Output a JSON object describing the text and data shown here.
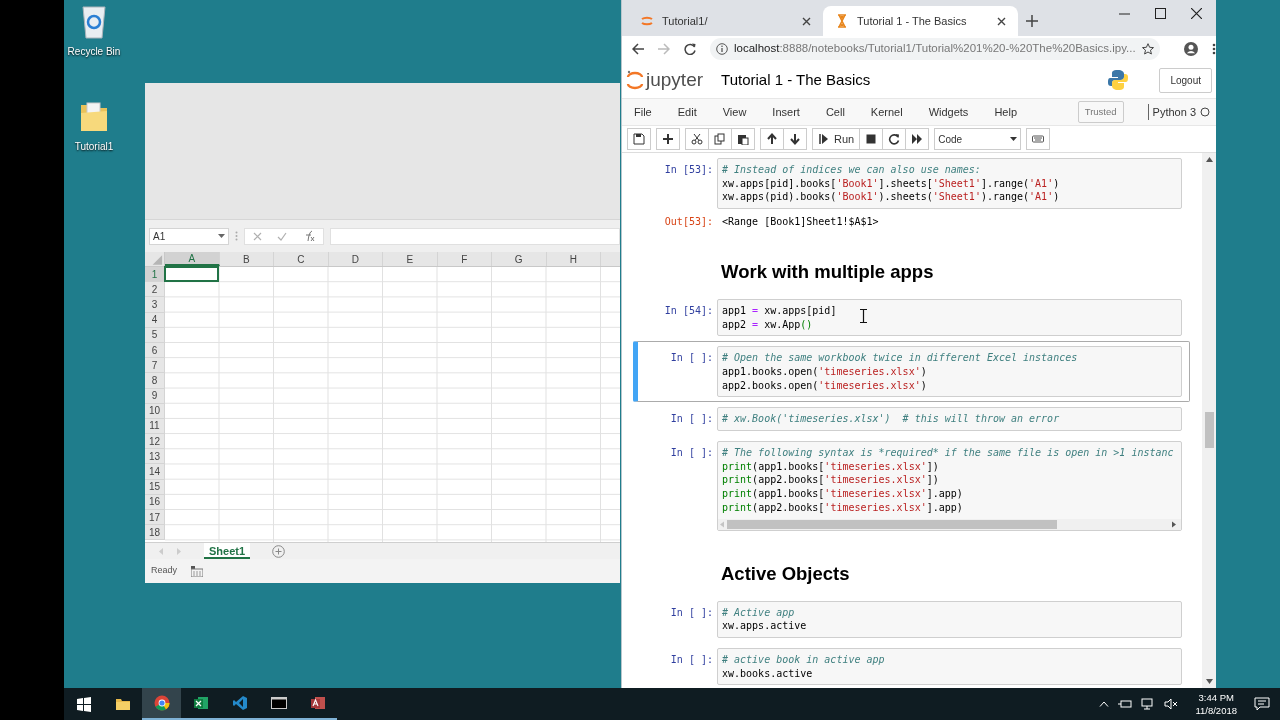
{
  "desktop_icons": [
    {
      "kind": "recycle",
      "label": "Recycle Bin"
    },
    {
      "kind": "folder",
      "label": "Tutorial1"
    }
  ],
  "excel": {
    "name_box": "A1",
    "columns": [
      {
        "label": "A",
        "selected": true
      },
      {
        "label": "B",
        "selected": false
      },
      {
        "label": "C",
        "selected": false
      },
      {
        "label": "D",
        "selected": false
      },
      {
        "label": "E",
        "selected": false
      },
      {
        "label": "F",
        "selected": false
      },
      {
        "label": "G",
        "selected": false
      },
      {
        "label": "H",
        "selected": false
      }
    ],
    "rows": [
      {
        "label": "1",
        "selected": true
      },
      {
        "label": "2",
        "selected": false
      },
      {
        "label": "3",
        "selected": false
      },
      {
        "label": "4",
        "selected": false
      },
      {
        "label": "5",
        "selected": false
      },
      {
        "label": "6",
        "selected": false
      },
      {
        "label": "7",
        "selected": false
      },
      {
        "label": "8",
        "selected": false
      },
      {
        "label": "9",
        "selected": false
      },
      {
        "label": "10",
        "selected": false
      },
      {
        "label": "11",
        "selected": false
      },
      {
        "label": "12",
        "selected": false
      },
      {
        "label": "13",
        "selected": false
      },
      {
        "label": "14",
        "selected": false
      },
      {
        "label": "15",
        "selected": false
      },
      {
        "label": "16",
        "selected": false
      },
      {
        "label": "17",
        "selected": false
      },
      {
        "label": "18",
        "selected": false
      }
    ],
    "sheet_tabs": [
      {
        "label": "Sheet1",
        "selected": true
      }
    ],
    "status": "Ready"
  },
  "browser": {
    "tabs": [
      {
        "kind": "jupyter",
        "title": "Tutorial1/",
        "selected": false
      },
      {
        "kind": "busy",
        "title": "Tutorial 1 - The Basics",
        "selected": true
      }
    ],
    "url": {
      "host": "localhost",
      "path": ":8888/notebooks/Tutorial1/Tutorial%201%20-%20The%20Basics.ipy..."
    }
  },
  "jupyter": {
    "brand": "jupyter",
    "title": "Tutorial 1 - The Basics",
    "logout": "Logout",
    "menu": [
      "File",
      "Edit",
      "View",
      "Insert",
      "Cell",
      "Kernel",
      "Widgets",
      "Help"
    ],
    "trusted": "Trusted",
    "kernel": "Python 3",
    "run": "Run",
    "cell_type": "Code",
    "cells": [
      {
        "kind": "code",
        "prompt": "In [53]:",
        "selected": false,
        "scrollable": false,
        "lines": [
          [
            {
              "kind": "comment",
              "text": "# Instead of indices we can also use names:"
            }
          ],
          [
            {
              "kind": "plain",
              "text": "xw.apps[pid].books["
            },
            {
              "kind": "string",
              "text": "'Book1'"
            },
            {
              "kind": "plain",
              "text": "].sheets["
            },
            {
              "kind": "string",
              "text": "'Sheet1'"
            },
            {
              "kind": "plain",
              "text": "].range("
            },
            {
              "kind": "string",
              "text": "'A1'"
            },
            {
              "kind": "plain",
              "text": ")"
            }
          ],
          [
            {
              "kind": "plain",
              "text": "xw.apps(pid).books("
            },
            {
              "kind": "string",
              "text": "'Book1'"
            },
            {
              "kind": "plain",
              "text": ").sheets("
            },
            {
              "kind": "string",
              "text": "'Sheet1'"
            },
            {
              "kind": "plain",
              "text": ").range("
            },
            {
              "kind": "string",
              "text": "'A1'"
            },
            {
              "kind": "plain",
              "text": ")"
            }
          ]
        ],
        "output": {
          "prompt": "Out[53]:",
          "text": "<Range [Book1]Sheet1!$A$1>"
        }
      },
      {
        "kind": "heading",
        "text": "Work with multiple apps",
        "selected": false
      },
      {
        "kind": "code",
        "prompt": "In [54]:",
        "selected": false,
        "scrollable": false,
        "lines": [
          [
            {
              "kind": "plain",
              "text": "app1 "
            },
            {
              "kind": "operator",
              "text": "="
            },
            {
              "kind": "plain",
              "text": " xw.apps[pid]"
            }
          ],
          [
            {
              "kind": "plain",
              "text": "app2 "
            },
            {
              "kind": "operator",
              "text": "="
            },
            {
              "kind": "plain",
              "text": " xw.App"
            },
            {
              "kind": "bracket",
              "text": "()"
            }
          ]
        ]
      },
      {
        "kind": "code",
        "prompt": "In [ ]:",
        "selected": true,
        "scrollable": false,
        "lines": [
          [
            {
              "kind": "comment",
              "text": "# Open the same workbook twice in different Excel instances"
            }
          ],
          [
            {
              "kind": "plain",
              "text": "app1.books.open("
            },
            {
              "kind": "string",
              "text": "'timeseries.xlsx'"
            },
            {
              "kind": "plain",
              "text": ")"
            }
          ],
          [
            {
              "kind": "plain",
              "text": "app2.books.open("
            },
            {
              "kind": "string",
              "text": "'timeseries.xlsx'"
            },
            {
              "kind": "plain",
              "text": ")"
            }
          ]
        ]
      },
      {
        "kind": "code",
        "prompt": "In [ ]:",
        "selected": false,
        "scrollable": false,
        "lines": [
          [
            {
              "kind": "comment",
              "text": "# xw.Book('timeseries.xlsx')  # this will throw an error"
            }
          ]
        ]
      },
      {
        "kind": "code",
        "prompt": "In [ ]:",
        "selected": false,
        "scrollable": true,
        "lines": [
          [
            {
              "kind": "comment",
              "text": "# The following syntax is *required* if the same file is open in >1 instanc"
            }
          ],
          [
            {
              "kind": "builtin",
              "text": "print"
            },
            {
              "kind": "plain",
              "text": "(app1.books["
            },
            {
              "kind": "string",
              "text": "'timeseries.xlsx'"
            },
            {
              "kind": "plain",
              "text": "])"
            }
          ],
          [
            {
              "kind": "builtin",
              "text": "print"
            },
            {
              "kind": "plain",
              "text": "(app2.books["
            },
            {
              "kind": "string",
              "text": "'timeseries.xlsx'"
            },
            {
              "kind": "plain",
              "text": "])"
            }
          ],
          [
            {
              "kind": "builtin",
              "text": "print"
            },
            {
              "kind": "plain",
              "text": "(app1.books["
            },
            {
              "kind": "string",
              "text": "'timeseries.xlsx'"
            },
            {
              "kind": "plain",
              "text": "].app)"
            }
          ],
          [
            {
              "kind": "builtin",
              "text": "print"
            },
            {
              "kind": "plain",
              "text": "(app2.books["
            },
            {
              "kind": "string",
              "text": "'timeseries.xlsx'"
            },
            {
              "kind": "plain",
              "text": "].app)"
            }
          ]
        ]
      },
      {
        "kind": "heading",
        "text": "Active Objects",
        "selected": false
      },
      {
        "kind": "code",
        "prompt": "In [ ]:",
        "selected": false,
        "scrollable": false,
        "lines": [
          [
            {
              "kind": "comment",
              "text": "# Active app"
            }
          ],
          [
            {
              "kind": "plain",
              "text": "xw.apps.active"
            }
          ]
        ]
      },
      {
        "kind": "code",
        "prompt": "In [ ]:",
        "selected": false,
        "scrollable": false,
        "lines": [
          [
            {
              "kind": "comment",
              "text": "# active book in active app"
            }
          ],
          [
            {
              "kind": "plain",
              "text": "xw.books.active"
            }
          ]
        ]
      }
    ]
  },
  "taskbar": {
    "apps": [
      {
        "kind": "start",
        "active": false,
        "running": false
      },
      {
        "kind": "explorer",
        "active": false,
        "running": false
      },
      {
        "kind": "chrome",
        "active": true,
        "running": true
      },
      {
        "kind": "excel",
        "active": false,
        "running": true
      },
      {
        "kind": "vscode",
        "active": false,
        "running": true
      },
      {
        "kind": "terminal",
        "active": false,
        "running": true
      },
      {
        "kind": "access",
        "active": false,
        "running": true
      }
    ],
    "time": "3:44 PM",
    "date": "11/8/2018"
  }
}
